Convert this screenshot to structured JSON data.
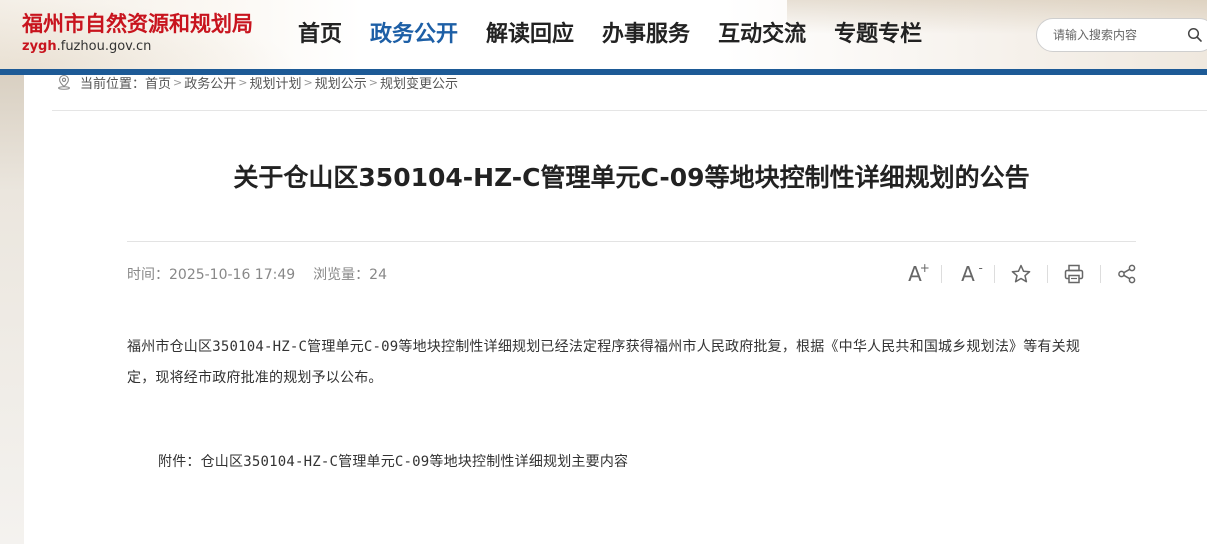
{
  "header": {
    "site_name": "福州市自然资源和规划局",
    "domain_prefix": "zygh",
    "domain_suffix": ".fuzhou.gov.cn",
    "nav": [
      {
        "label": "首页",
        "active": false
      },
      {
        "label": "政务公开",
        "active": true
      },
      {
        "label": "解读回应",
        "active": false
      },
      {
        "label": "办事服务",
        "active": false
      },
      {
        "label": "互动交流",
        "active": false
      },
      {
        "label": "专题专栏",
        "active": false
      }
    ],
    "search": {
      "placeholder": "请输入搜索内容",
      "icon": "search-icon"
    }
  },
  "breadcrumb": {
    "label": "当前位置：",
    "items": [
      "首页",
      "政务公开",
      "规划计划",
      "规划公示",
      "规划变更公示"
    ],
    "separator": ">"
  },
  "article": {
    "title": "关于仓山区350104-HZ-C管理单元C-09等地块控制性详细规划的公告",
    "meta": {
      "time_label": "时间：",
      "time_value": "2025-10-16 17:49",
      "views_label": "浏览量：",
      "views_value": "24"
    },
    "tools": {
      "font_increase": "A",
      "font_decrease": "A",
      "plus_sign": "+",
      "minus_sign": "-"
    },
    "paragraph_line1": "福州市仓山区350104-HZ-C管理单元C-09等地块控制性详细规划已经法定程序获得福州市人民政府批复，根据《中华人民共和国城乡规划法》等有关规",
    "paragraph_line2": "定，现将经市政府批准的规划予以公布。",
    "attachment": "附件：仓山区350104-HZ-C管理单元C-09等地块控制性详细规划主要内容"
  },
  "colors": {
    "brand_red": "#c8141e",
    "nav_active": "#1d5fa6",
    "header_bar": "#1d5a96"
  }
}
